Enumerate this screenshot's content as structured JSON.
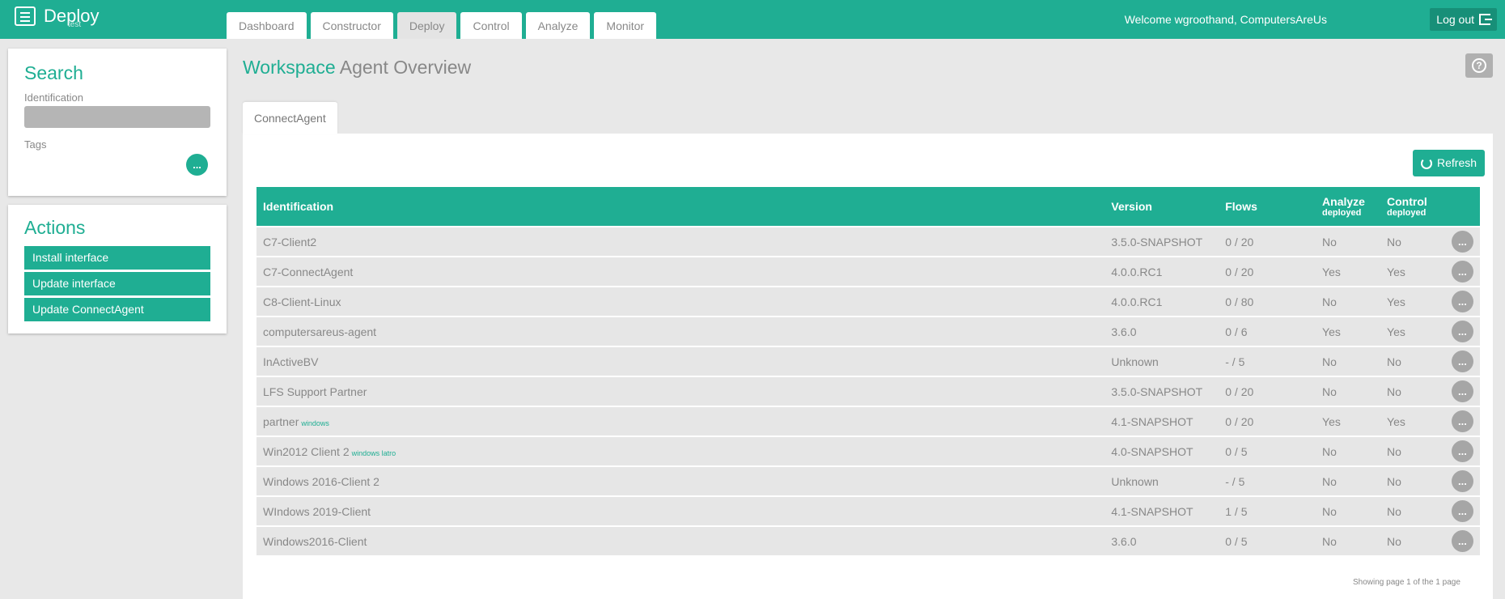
{
  "header": {
    "brand": "Deploy",
    "environment": "test",
    "tabs": [
      {
        "label": "Dashboard"
      },
      {
        "label": "Constructor"
      },
      {
        "label": "Deploy",
        "active": true
      },
      {
        "label": "Control"
      },
      {
        "label": "Analyze"
      },
      {
        "label": "Monitor"
      }
    ],
    "welcome": "Welcome wgroothand, ComputersAreUs",
    "logout_label": "Log out"
  },
  "sidebar": {
    "search": {
      "title": "Search",
      "identification_label": "Identification",
      "identification_value": "",
      "tags_label": "Tags",
      "more_label": "..."
    },
    "actions": {
      "title": "Actions",
      "buttons": [
        "Install interface",
        "Update interface",
        "Update ConnectAgent"
      ]
    }
  },
  "main": {
    "heading_prefix": "Workspace",
    "heading_title": "Agent Overview",
    "help_label": "?",
    "tab": "ConnectAgent",
    "refresh_label": "Refresh",
    "table": {
      "headers": {
        "identification": "Identification",
        "version": "Version",
        "flows": "Flows",
        "analyze_top": "Analyze",
        "analyze_bottom": "deployed",
        "control_top": "Control",
        "control_bottom": "deployed"
      },
      "rows": [
        {
          "id": "C7-Client2",
          "tag": "",
          "version": "3.5.0-SNAPSHOT",
          "flows": "0 / 20",
          "analyze": "No",
          "control": "No"
        },
        {
          "id": "C7-ConnectAgent",
          "tag": "",
          "version": "4.0.0.RC1",
          "flows": "0 / 20",
          "analyze": "Yes",
          "control": "Yes"
        },
        {
          "id": "C8-Client-Linux",
          "tag": "",
          "version": "4.0.0.RC1",
          "flows": "0 / 80",
          "analyze": "No",
          "control": "Yes"
        },
        {
          "id": "computersareus-agent",
          "tag": "",
          "version": "3.6.0",
          "flows": "0 / 6",
          "analyze": "Yes",
          "control": "Yes"
        },
        {
          "id": "InActiveBV",
          "tag": "",
          "version": "Unknown",
          "flows": "- / 5",
          "analyze": "No",
          "control": "No"
        },
        {
          "id": "LFS Support Partner",
          "tag": "",
          "version": "3.5.0-SNAPSHOT",
          "flows": "0 / 20",
          "analyze": "No",
          "control": "No"
        },
        {
          "id": "partner",
          "tag": "windows",
          "version": "4.1-SNAPSHOT",
          "flows": "0 / 20",
          "analyze": "Yes",
          "control": "Yes"
        },
        {
          "id": "Win2012 Client 2",
          "tag": "windows latro",
          "version": "4.0-SNAPSHOT",
          "flows": "0 / 5",
          "analyze": "No",
          "control": "No"
        },
        {
          "id": "Windows 2016-Client 2",
          "tag": "",
          "version": "Unknown",
          "flows": "- / 5",
          "analyze": "No",
          "control": "No"
        },
        {
          "id": "WIndows 2019-Client",
          "tag": "",
          "version": "4.1-SNAPSHOT",
          "flows": "1 / 5",
          "analyze": "No",
          "control": "No"
        },
        {
          "id": "Windows2016-Client",
          "tag": "",
          "version": "3.6.0",
          "flows": "0 / 5",
          "analyze": "No",
          "control": "No"
        }
      ],
      "row_action_label": "..."
    },
    "pagination": "Showing page 1 of the 1 page"
  },
  "colors": {
    "accent": "#1fae93",
    "background": "#e8e8e8",
    "row_background": "#e6e6e6"
  }
}
